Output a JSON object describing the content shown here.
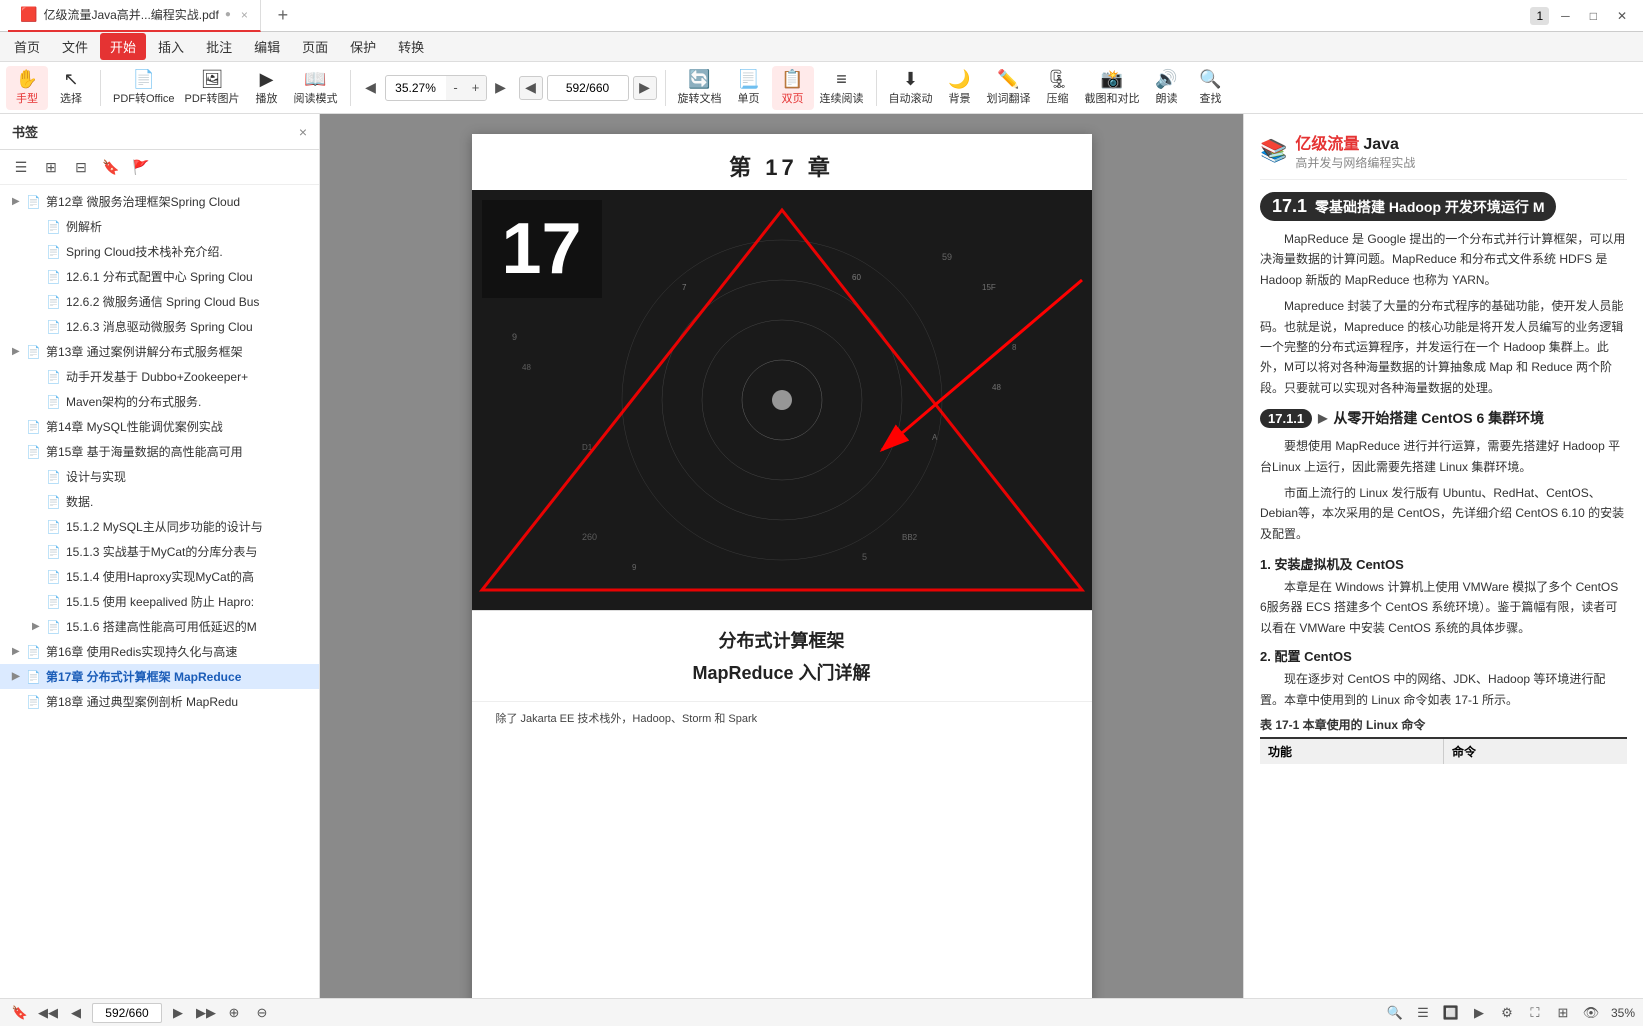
{
  "titlebar": {
    "tab_label": "亿级流量Java高并...编程实战.pdf",
    "add_tab_title": "新标签页",
    "page_num": "1"
  },
  "menubar": {
    "items": [
      "首页",
      "文件",
      "插入",
      "批注",
      "编辑",
      "页面",
      "保护",
      "转换"
    ],
    "active": "开始"
  },
  "toolbar": {
    "hand_tool": "手型",
    "select_tool": "选择",
    "pdf_to_office": "PDF转Office",
    "pdf_to_image": "PDF转图片",
    "play": "播放",
    "read_mode": "阅读模式",
    "rotate": "旋转文档",
    "single_page": "单页",
    "double_page": "双页",
    "continuous": "连续阅读",
    "auto_scroll": "自动滚动",
    "background": "背景",
    "word_translate": "划词翻译",
    "compress": "压缩",
    "screenshot_compare": "截图和对比",
    "read_aloud": "朗读",
    "search": "查找",
    "zoom_value": "35.27%",
    "zoom_in": "+",
    "zoom_out": "-",
    "page_current": "592",
    "page_total": "660"
  },
  "sidebar": {
    "title": "书签",
    "close_btn": "×",
    "items": [
      {
        "label": "第12章 微服务治理框架Spring Cloud",
        "level": 1,
        "has_arrow": true,
        "icon": "📄"
      },
      {
        "label": "例解析",
        "level": 2,
        "has_arrow": false,
        "icon": "📄",
        "indent": 1
      },
      {
        "label": "Spring Cloud技术栈补充介绍.",
        "level": 2,
        "has_arrow": false,
        "icon": "📄",
        "indent": 1
      },
      {
        "label": "12.6.1 分布式配置中心 Spring Clou",
        "level": 2,
        "has_arrow": false,
        "icon": "📄",
        "indent": 1
      },
      {
        "label": "12.6.2 微服务通信 Spring Cloud Bus",
        "level": 2,
        "has_arrow": false,
        "icon": "📄",
        "indent": 1
      },
      {
        "label": "12.6.3 消息驱动微服务 Spring Clou",
        "level": 2,
        "has_arrow": false,
        "icon": "📄",
        "indent": 1
      },
      {
        "label": "第13章 通过案例讲解分布式服务框架",
        "level": 1,
        "has_arrow": true,
        "icon": "📄"
      },
      {
        "label": "动手开发基于 Dubbo+Zookeeper+",
        "level": 2,
        "has_arrow": false,
        "icon": "📄",
        "indent": 1
      },
      {
        "label": "Maven架构的分布式服务.",
        "level": 2,
        "has_arrow": false,
        "icon": "📄",
        "indent": 1
      },
      {
        "label": "第14章 MySQL性能调优案例实战",
        "level": 1,
        "has_arrow": false,
        "icon": "📄"
      },
      {
        "label": "第15章 基于海量数据的高性能高可用",
        "level": 1,
        "has_arrow": false,
        "icon": "📄"
      },
      {
        "label": "设计与实现",
        "level": 2,
        "has_arrow": false,
        "icon": "📄",
        "indent": 1
      },
      {
        "label": "数据.",
        "level": 2,
        "has_arrow": false,
        "icon": "📄",
        "indent": 1
      },
      {
        "label": "15.1.2 MySQL主从同步功能的设计与",
        "level": 2,
        "has_arrow": false,
        "icon": "📄",
        "indent": 1
      },
      {
        "label": "15.1.3 实战基于MyCat的分库分表与",
        "level": 2,
        "has_arrow": false,
        "icon": "📄",
        "indent": 1
      },
      {
        "label": "15.1.4 使用Haproxy实现MyCat的高",
        "level": 2,
        "has_arrow": false,
        "icon": "📄",
        "indent": 1
      },
      {
        "label": "15.1.5 使用 keepalived 防止 Hapro:",
        "level": 2,
        "has_arrow": false,
        "icon": "📄",
        "indent": 1
      },
      {
        "label": "15.1.6 搭建高性能高可用低延迟的M",
        "level": 2,
        "has_arrow": true,
        "icon": "📄",
        "indent": 1
      },
      {
        "label": "第16章 使用Redis实现持久化与高速",
        "level": 1,
        "has_arrow": true,
        "icon": "📄"
      },
      {
        "label": "第17章 分布式计算框架 MapReduce",
        "level": 1,
        "has_arrow": true,
        "icon": "📄",
        "active": true
      },
      {
        "label": "第18章 通过典型案例剖析 MapRedu",
        "level": 1,
        "has_arrow": false,
        "icon": "📄"
      }
    ]
  },
  "pdf_page": {
    "chapter_num": "17",
    "chapter_title": "第 17 章",
    "subtitle1": "分布式计算框架",
    "subtitle2": "MapReduce 入门详解",
    "footer_text": "除了 Jakarta EE 技术栈外，Hadoop、Storm 和 Spark"
  },
  "right_panel": {
    "book_icon": "📚",
    "book_title": "亿级流量 Java",
    "book_subtitle": "高并发与网络编程实战",
    "section171_label": "17.1",
    "section171_title": "零基础搭建 Hadoop 开发环境运行 M",
    "para1": "MapReduce 是 Google 提出的一个分布式并行计算框架，可以用决海量数据的计算问题。MapReduce 和分布式文件系统 HDFS 是 Hadoop 新版的 MapReduce 也称为 YARN。",
    "para2": "Mapreduce 封装了大量的分布式程序的基础功能，使开发人员能码。也就是说，Mapreduce 的核心功能是将开发人员编写的业务逻辑一个完整的分布式运算程序，并发运行在一个 Hadoop 集群上。此外，M可以将对各种海量数据的计算抽象成 Map 和 Reduce 两个阶段。只要就可以实现对各种海量数据的处理。",
    "section1711_label": "17.1.1",
    "section1711_play": "▶",
    "section1711_title": "从零开始搭建 CentOS 6 集群环境",
    "para3": "要想使用 MapReduce 进行并行运算，需要先搭建好 Hadoop 平台Linux 上运行，因此需要先搭建 Linux 集群环境。",
    "para4": "市面上流行的 Linux 发行版有 Ubuntu、RedHat、CentOS、Debian等，本次采用的是 CentOS，先详细介绍 CentOS 6.10 的安装及配置。",
    "subheading1": "1. 安装虚拟机及 CentOS",
    "para5": "本章是在 Windows 计算机上使用 VMWare 模拟了多个 CentOS 6服务器 ECS 搭建多个 CentOS 系统环境）。鉴于篇幅有限，读者可以看在 VMWare 中安装 CentOS 系统的具体步骤。",
    "subheading2": "2. 配置 CentOS",
    "para6": "现在逐步对 CentOS 中的网络、JDK、Hadoop 等环境进行配置。本章中使用到的 Linux 命令如表 17-1 所示。",
    "table_title": "表 17-1  本章使用的 Linux 命令",
    "table_headers": [
      "功能",
      "命令"
    ],
    "func_label": "功能",
    "cmd_label": "命令"
  },
  "statusbar": {
    "page_current": "592",
    "page_total": "660",
    "zoom": "35%"
  }
}
